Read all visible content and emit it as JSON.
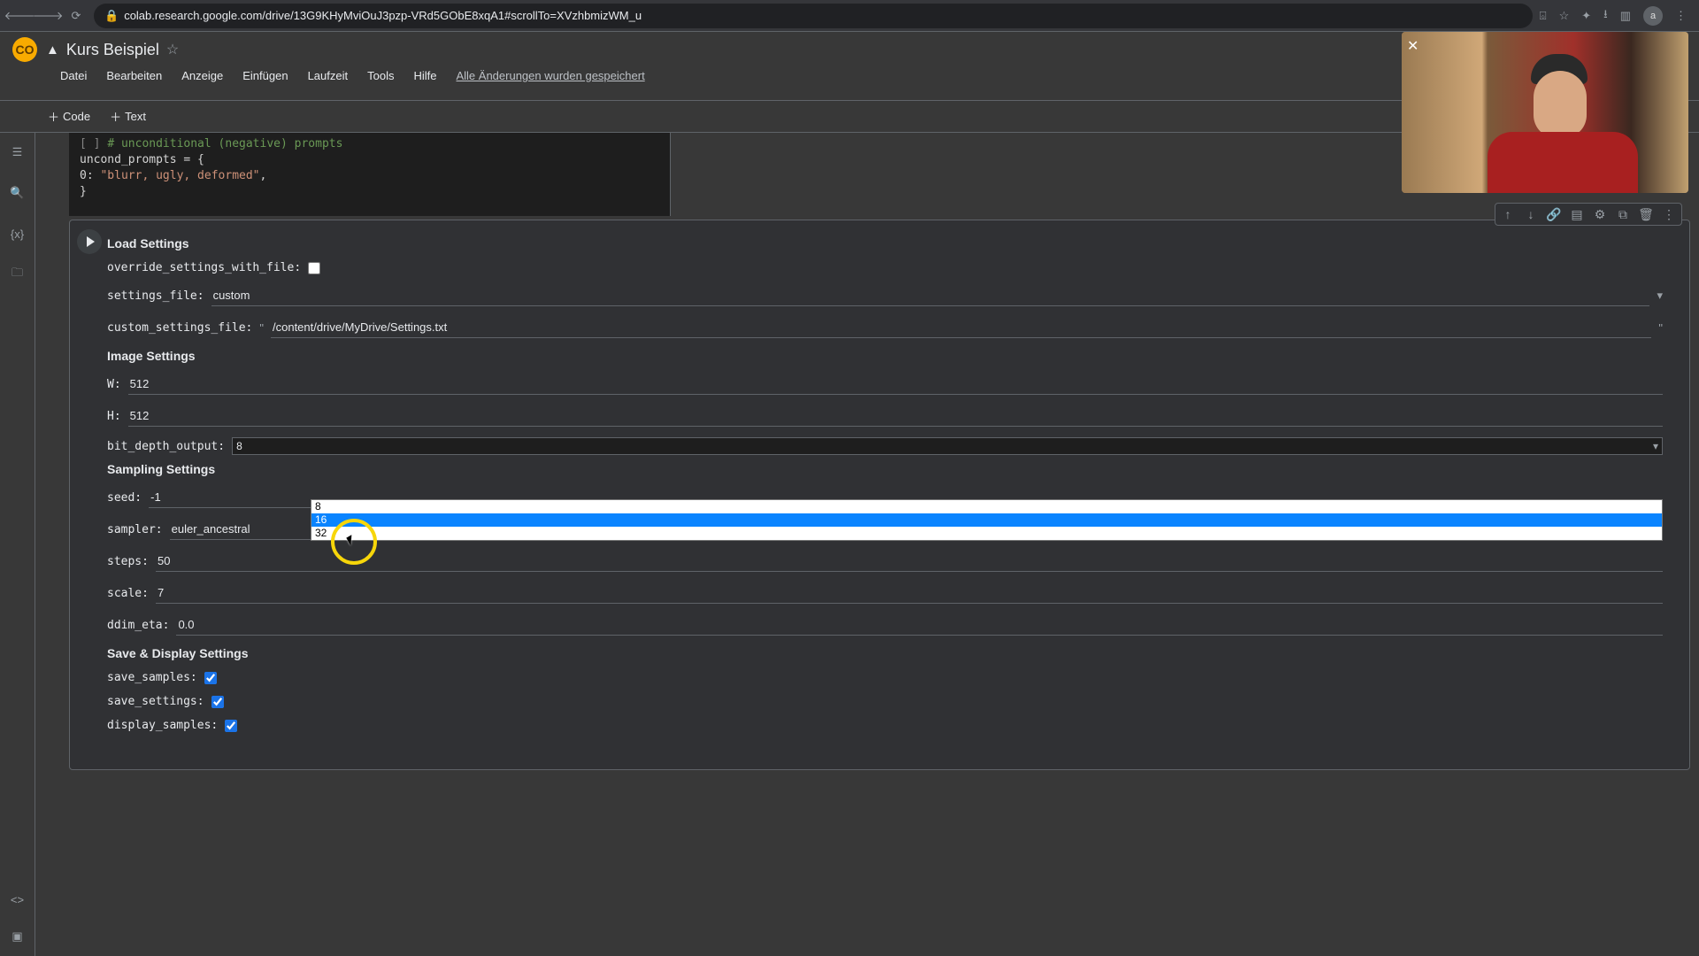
{
  "browser": {
    "url": "colab.research.google.com/drive/13G9KHyMviOuJ3pzp-VRd5GObE8xqA1#scrollTo=XVzhbmizWM_u",
    "avatar": "a"
  },
  "header": {
    "title": "Kurs Beispiel",
    "menu": [
      "Datei",
      "Bearbeiten",
      "Anzeige",
      "Einfügen",
      "Laufzeit",
      "Tools",
      "Hilfe"
    ],
    "status": "Alle Änderungen wurden gespeichert"
  },
  "toolbar": {
    "code": "Code",
    "text": "Text"
  },
  "code_cell": {
    "comment": "# unconditional (negative) prompts",
    "line1": "uncond_prompts = {",
    "line2a": "    0: ",
    "line2b": "\"blurr, ugly, deformed\"",
    "line2c": ",",
    "line3": "}"
  },
  "form": {
    "load_settings_title": "Load Settings",
    "override_label": "override_settings_with_file:",
    "settings_file_label": "settings_file:",
    "settings_file_value": "custom",
    "custom_settings_file_label": "custom_settings_file:",
    "custom_settings_file_value": "/content/drive/MyDrive/Settings.txt",
    "image_settings_title": "Image Settings",
    "w_label": "W:",
    "w_value": "512",
    "h_label": "H:",
    "h_value": "512",
    "bit_depth_label": "bit_depth_output:",
    "bit_depth_selected": "8",
    "bit_depth_options": [
      "8",
      "16",
      "32"
    ],
    "sampling_title": "Sampling Settings",
    "seed_label": "seed:",
    "seed_value": "-1",
    "sampler_label": "sampler:",
    "sampler_value": "euler_ancestral",
    "steps_label": "steps:",
    "steps_value": "50",
    "scale_label": "scale:",
    "scale_value": "7",
    "ddim_label": "ddim_eta:",
    "ddim_value": "0.0",
    "save_display_title": "Save & Display Settings",
    "save_samples_label": "save_samples:",
    "save_settings_label": "save_settings:",
    "display_samples_label": "display_samples:"
  }
}
